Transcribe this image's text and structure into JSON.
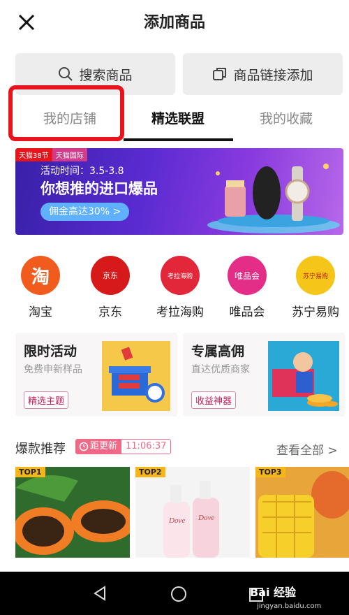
{
  "header": {
    "title": "添加商品"
  },
  "search": {
    "search_label": "搜索商品",
    "link_label": "商品链接添加"
  },
  "tabs": [
    {
      "label": "我的店铺"
    },
    {
      "label": "精选联盟"
    },
    {
      "label": "我的收藏"
    }
  ],
  "banner": {
    "tag1": "天猫38节",
    "tag2": "天猫国际",
    "date": "活动时间：3.5-3.8",
    "headline": "你想推的进口爆品",
    "cta": "佣金高达30% >"
  },
  "platforms": [
    {
      "label": "淘宝",
      "logo": "淘",
      "color": "#f25b1e"
    },
    {
      "label": "京东",
      "logo": "京东",
      "color": "#d61a1a"
    },
    {
      "label": "考拉海购",
      "logo": "考拉海购",
      "color": "#e3273a"
    },
    {
      "label": "唯品会",
      "logo": "唯品会",
      "color": "#e32d86"
    },
    {
      "label": "苏宁易购",
      "logo": "苏宁易购",
      "color": "#f6c51a"
    }
  ],
  "promo": [
    {
      "title": "限时活动",
      "subtitle": "免费申新样品",
      "tag": "精选主题"
    },
    {
      "title": "专属高佣",
      "subtitle": "直达优质商家",
      "tag": "收益神器"
    }
  ],
  "hot": {
    "title": "爆款推荐",
    "timer_label": "距更新",
    "timer_value": "11:06:37",
    "see_all": "查看全部 >"
  },
  "products": [
    {
      "badge": "TOP1"
    },
    {
      "badge": "TOP2"
    },
    {
      "badge": "TOP3"
    }
  ],
  "watermark": {
    "brand": "Bai 经验",
    "url": "jingyan.baidu.com"
  }
}
